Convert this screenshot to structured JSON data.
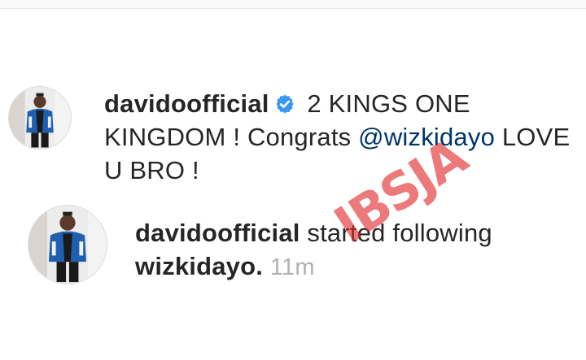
{
  "notifications": [
    {
      "username": "davidoofficial",
      "verified": true,
      "verified_icon": "verified-badge-icon",
      "message_part1": " 2 KINGS ONE KINGDOM ! Congrats ",
      "mention": "@wizkidayo",
      "message_part2": " LOVE U BRO !"
    },
    {
      "username": "davidoofficial",
      "action": " started following ",
      "target": "wizkidayo.",
      "timestamp": "11m"
    }
  ],
  "watermark": "IBSJA",
  "colors": {
    "text": "#262626",
    "mention": "#003569",
    "verified_badge": "#3897f0",
    "timestamp": "#b0b0b0",
    "watermark": "#e02828"
  }
}
